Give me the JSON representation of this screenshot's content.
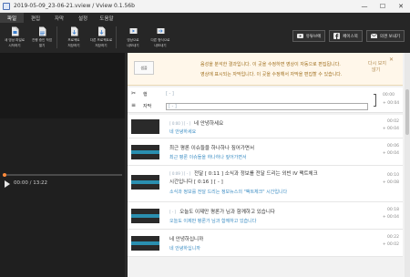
{
  "window": {
    "title": "2019-05-09_23-06-21.vview / Vview 0.1.56b",
    "minimize": "—",
    "maximize": "☐",
    "close": "✕"
  },
  "ribbon": {
    "tabs": [
      "파일",
      "편집",
      "자막",
      "설정",
      "도움말"
    ],
    "tools": [
      {
        "label1": "새 영상 파일로",
        "label2": "시작하기",
        "icon": "new-file-icon"
      },
      {
        "label1": "진행 중인 작업",
        "label2": "열기",
        "icon": "open-file-icon"
      },
      {
        "label1": "프로젝트",
        "label2": "저장하기",
        "icon": "save-project-icon"
      },
      {
        "label1": "다른 프로젝트로",
        "label2": "저장하기",
        "icon": "save-as-icon"
      },
      {
        "label1": "영상으로",
        "label2": "내보내기",
        "icon": "export-video-icon"
      },
      {
        "label1": "다른 형식으로",
        "label2": "내보내기",
        "icon": "export-format-icon"
      }
    ],
    "share_youtube": "유튜브에",
    "share_facebook": "페이스북",
    "share_mail": "의견 보내기"
  },
  "player": {
    "progress": 0.01,
    "timecode": "00:00 / 13:22"
  },
  "notice": {
    "sample": "샘플",
    "line1": "음성을 분석한 결과입니다. 이 곳을 수정하면 영상이 자동으로 편집됩니다.",
    "line2": "영상에 표시되는 자막입니다. 이 곳을 수정해서 자막을 편집할 수 있습니다.",
    "dismiss1": "다시 보지",
    "dismiss2": "않기",
    "dismiss_x": "✕"
  },
  "editor": {
    "row1_icon": "✂",
    "row1_label": "행",
    "row1_placeholder": "[ - ]",
    "row2_icon": "≡",
    "row2_label": "자막",
    "row2_placeholder": "[ - ]",
    "time_start": "00:00",
    "time_end": "+ 00:04"
  },
  "rows": [
    {
      "ts": "[ 0:00 ] [ - ]",
      "speech": "네 안녕하세요",
      "subtitle": "네 안녕하세요",
      "start": "00:02",
      "end": "+ 00:04"
    },
    {
      "ts": "",
      "speech": "최근 평론 이슈들을 하나하나 짚어가면서",
      "subtitle": "최근 평론 이슈들을 하나하나 짚어가면서",
      "start": "00:06",
      "end": "+ 00:04"
    },
    {
      "ts": "[ 0:09 ] [ - ]",
      "speech": "전달 [ 0:11 ] 소식과 정보를 전달 드리는 외빈 IV 팩트체크",
      "speech2": "시간입니다 [ 0:16 ] [ - ]",
      "subtitle": "소식과 정보를 전달 드리는 정보뉴스의 \"팩트체크\" 시간입니다",
      "start": "00:10",
      "end": "+ 00:08"
    },
    {
      "ts": "[ - ]",
      "speech": "오늘도 이제만 평론가 님과 함께하고 있습니다",
      "subtitle": "오늘도 이제만 평론가 님과 함께하고 있습니다",
      "start": "00:18",
      "end": "+ 00:04"
    },
    {
      "ts": "",
      "speech": "네 안녕하십니까",
      "subtitle": "네 안녕하십니까",
      "start": "00:22",
      "end": "+ 00:02"
    }
  ]
}
